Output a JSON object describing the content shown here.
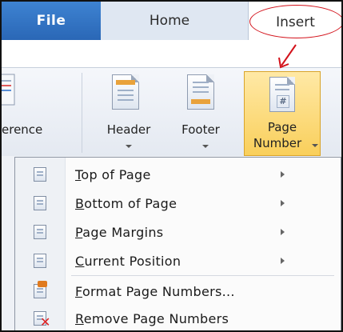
{
  "tabs": {
    "file": "File",
    "home": "Home",
    "insert": "Insert"
  },
  "ribbon": {
    "reference_partial": "erence",
    "header": {
      "line1": "Header",
      "icon": "header-doc-icon"
    },
    "footer": {
      "line1": "Footer",
      "icon": "footer-doc-icon"
    },
    "page_number": {
      "line1": "Page",
      "line2": "Number",
      "icon": "page-number-doc-icon"
    }
  },
  "menu": {
    "items": [
      {
        "label_first": "T",
        "label_rest": "op of Page",
        "submenu": true,
        "icon": "top-of-page-icon"
      },
      {
        "label_first": "B",
        "label_rest": "ottom of Page",
        "submenu": true,
        "icon": "bottom-of-page-icon"
      },
      {
        "label_first": "P",
        "label_rest": "age Margins",
        "submenu": true,
        "icon": "page-margins-icon"
      },
      {
        "label_first": "C",
        "label_rest": "urrent Position",
        "submenu": true,
        "icon": "current-position-icon"
      },
      {
        "label_first": "F",
        "label_rest": "ormat Page Numbers...",
        "submenu": false,
        "icon": "format-page-numbers-icon"
      },
      {
        "label_first": "R",
        "label_rest": "emove Page Numbers",
        "submenu": false,
        "icon": "remove-page-numbers-icon"
      }
    ]
  },
  "colors": {
    "file_tab": "#2a67b6",
    "highlight": "#f9cf5b",
    "annotation": "#d3121b"
  }
}
